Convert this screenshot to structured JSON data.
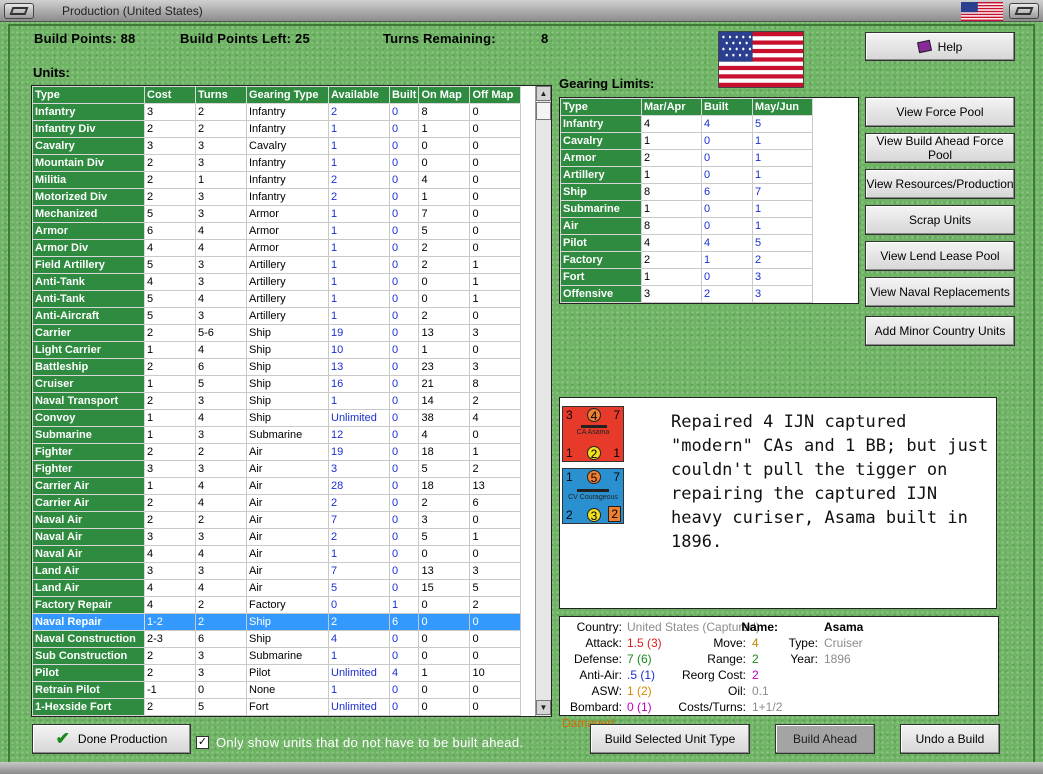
{
  "window": {
    "title": "Production (United States)"
  },
  "header": {
    "build_points": "Build Points: 88",
    "build_points_left": "Build Points Left: 25",
    "turns_remaining_label": "Turns Remaining:",
    "turns_remaining_value": "8"
  },
  "units": {
    "label": "Units:",
    "columns": [
      "Type",
      "Cost",
      "Turns",
      "Gearing Type",
      "Available",
      "Built",
      "On Map",
      "Off Map"
    ],
    "rows": [
      [
        "Infantry",
        "3",
        "2",
        "Infantry",
        "2",
        "0",
        "8",
        "0"
      ],
      [
        "Infantry Div",
        "2",
        "2",
        "Infantry",
        "1",
        "0",
        "1",
        "0"
      ],
      [
        "Cavalry",
        "3",
        "3",
        "Cavalry",
        "1",
        "0",
        "0",
        "0"
      ],
      [
        "Mountain Div",
        "2",
        "3",
        "Infantry",
        "1",
        "0",
        "0",
        "0"
      ],
      [
        "Militia",
        "2",
        "1",
        "Infantry",
        "2",
        "0",
        "4",
        "0"
      ],
      [
        "Motorized Div",
        "2",
        "3",
        "Infantry",
        "2",
        "0",
        "1",
        "0"
      ],
      [
        "Mechanized",
        "5",
        "3",
        "Armor",
        "1",
        "0",
        "7",
        "0"
      ],
      [
        "Armor",
        "6",
        "4",
        "Armor",
        "1",
        "0",
        "5",
        "0"
      ],
      [
        "Armor Div",
        "4",
        "4",
        "Armor",
        "1",
        "0",
        "2",
        "0"
      ],
      [
        "Field Artillery",
        "5",
        "3",
        "Artillery",
        "1",
        "0",
        "2",
        "1"
      ],
      [
        "Anti-Tank",
        "4",
        "3",
        "Artillery",
        "1",
        "0",
        "0",
        "1"
      ],
      [
        "Anti-Tank",
        "5",
        "4",
        "Artillery",
        "1",
        "0",
        "0",
        "1"
      ],
      [
        "Anti-Aircraft",
        "5",
        "3",
        "Artillery",
        "1",
        "0",
        "2",
        "0"
      ],
      [
        "Carrier",
        "2",
        "5-6",
        "Ship",
        "19",
        "0",
        "13",
        "3"
      ],
      [
        "Light Carrier",
        "1",
        "4",
        "Ship",
        "10",
        "0",
        "1",
        "0"
      ],
      [
        "Battleship",
        "2",
        "6",
        "Ship",
        "13",
        "0",
        "23",
        "3"
      ],
      [
        "Cruiser",
        "1",
        "5",
        "Ship",
        "16",
        "0",
        "21",
        "8"
      ],
      [
        "Naval Transport",
        "2",
        "3",
        "Ship",
        "1",
        "0",
        "14",
        "2"
      ],
      [
        "Convoy",
        "1",
        "4",
        "Ship",
        "Unlimited",
        "0",
        "38",
        "4"
      ],
      [
        "Submarine",
        "1",
        "3",
        "Submarine",
        "12",
        "0",
        "4",
        "0"
      ],
      [
        "Fighter",
        "2",
        "2",
        "Air",
        "19",
        "0",
        "18",
        "1"
      ],
      [
        "Fighter",
        "3",
        "3",
        "Air",
        "3",
        "0",
        "5",
        "2"
      ],
      [
        "Carrier Air",
        "1",
        "4",
        "Air",
        "28",
        "0",
        "18",
        "13"
      ],
      [
        "Carrier Air",
        "2",
        "4",
        "Air",
        "2",
        "0",
        "2",
        "6"
      ],
      [
        "Naval Air",
        "2",
        "2",
        "Air",
        "7",
        "0",
        "3",
        "0"
      ],
      [
        "Naval Air",
        "3",
        "3",
        "Air",
        "2",
        "0",
        "5",
        "1"
      ],
      [
        "Naval Air",
        "4",
        "4",
        "Air",
        "1",
        "0",
        "0",
        "0"
      ],
      [
        "Land Air",
        "3",
        "3",
        "Air",
        "7",
        "0",
        "13",
        "3"
      ],
      [
        "Land Air",
        "4",
        "4",
        "Air",
        "5",
        "0",
        "15",
        "5"
      ],
      [
        "Factory Repair",
        "4",
        "2",
        "Factory",
        "0",
        "1",
        "0",
        "2"
      ],
      [
        "Naval Repair",
        "1-2",
        "2",
        "Ship",
        "2",
        "6",
        "0",
        "0"
      ],
      [
        "Naval Construction",
        "2-3",
        "6",
        "Ship",
        "4",
        "0",
        "0",
        "0"
      ],
      [
        "Sub Construction",
        "2",
        "3",
        "Submarine",
        "1",
        "0",
        "0",
        "0"
      ],
      [
        "Pilot",
        "2",
        "3",
        "Pilot",
        "Unlimited",
        "4",
        "1",
        "10"
      ],
      [
        "Retrain Pilot",
        "-1",
        "0",
        "None",
        "1",
        "0",
        "0",
        "0"
      ],
      [
        "1-Hexside Fort",
        "2",
        "5",
        "Fort",
        "Unlimited",
        "0",
        "0",
        "0"
      ]
    ]
  },
  "gearing": {
    "label": "Gearing Limits:",
    "columns": [
      "Type",
      "Mar/Apr",
      "Built",
      "May/Jun"
    ],
    "rows": [
      [
        "Infantry",
        "4",
        "4",
        "5"
      ],
      [
        "Cavalry",
        "1",
        "0",
        "1"
      ],
      [
        "Armor",
        "2",
        "0",
        "1"
      ],
      [
        "Artillery",
        "1",
        "0",
        "1"
      ],
      [
        "Ship",
        "8",
        "6",
        "7"
      ],
      [
        "Submarine",
        "1",
        "0",
        "1"
      ],
      [
        "Air",
        "8",
        "0",
        "1"
      ],
      [
        "Pilot",
        "4",
        "4",
        "5"
      ],
      [
        "Factory",
        "2",
        "1",
        "2"
      ],
      [
        "Fort",
        "1",
        "0",
        "3"
      ],
      [
        "Offensive",
        "3",
        "2",
        "3"
      ]
    ]
  },
  "buttons": {
    "help": "Help",
    "view_force_pool": "View Force Pool",
    "view_build_ahead": "View Build Ahead Force Pool",
    "view_resources": "View Resources/Production",
    "scrap_units": "Scrap Units",
    "view_lend_lease": "View Lend Lease Pool",
    "view_naval_replacements": "View Naval Replacements",
    "add_minor": "Add Minor Country Units",
    "done_production": "Done Production",
    "build_selected": "Build Selected Unit Type",
    "build_ahead": "Build Ahead",
    "undo_build": "Undo a Build"
  },
  "checkbox": {
    "label": "Only show units that do not have to be built ahead.",
    "checked": true
  },
  "description": "Repaired 4 IJN captured \"modern\" CAs and 1 BB; but just couldn't pull the tigger on repairing the captured IJN heavy curiser, Asama built in 1896.",
  "counters": {
    "ca": {
      "tl": "3",
      "tc": "4",
      "tr": "7",
      "name": "CA Asama",
      "bl": "1",
      "bc": "2",
      "br": "1",
      "color": "#e83a2a"
    },
    "cv": {
      "tl": "1",
      "tc": "5",
      "tr": "7",
      "name": "CV Courageous",
      "bl": "2",
      "bc": "3",
      "br": "2",
      "color": "#2a90d0"
    }
  },
  "info": {
    "country_label": "Country:",
    "country": "United States (Captured)",
    "attack_label": "Attack:",
    "attack": "1.5 (3)",
    "defense_label": "Defense:",
    "defense": "7 (6)",
    "antiair_label": "Anti-Air:",
    "antiair": ".5 (1)",
    "asw_label": "ASW:",
    "asw": "1 (2)",
    "bombard_label": "Bombard:",
    "bombard": "0 (1)",
    "status": "Damaged",
    "move_label": "Move:",
    "move": "4",
    "range_label": "Range:",
    "range": "2",
    "reorg_label": "Reorg Cost:",
    "reorg": "2",
    "oil_label": "Oil:",
    "oil": "0.1",
    "costs_label": "Costs/Turns:",
    "costs": "1+1/2",
    "name_label": "Name:",
    "name": "Asama",
    "type_label": "Type:",
    "type": "Cruiser",
    "year_label": "Year:",
    "year": "1896"
  },
  "colors": {
    "attack": "#d81e1e",
    "defense": "#1a8a1a",
    "antiair": "#1a2fd0",
    "asw": "#d88a00",
    "bombard": "#c000c0",
    "damaged": "#d86a00",
    "gray": "#8c8c8c",
    "move": "#b08a00",
    "range": "#1a8a1a",
    "reorg": "#c000c0"
  }
}
